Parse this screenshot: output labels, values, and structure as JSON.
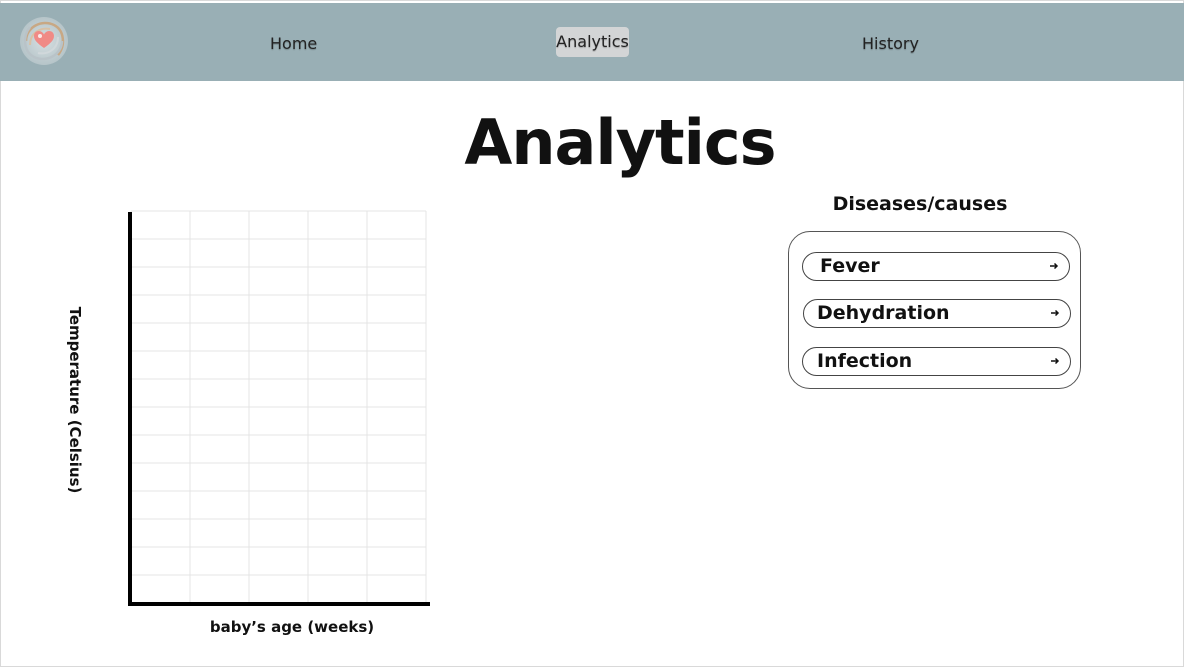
{
  "nav": {
    "logo_name": "heart-swirl-logo",
    "items": [
      {
        "label": "Home",
        "active": false
      },
      {
        "label": "Analytics",
        "active": true
      },
      {
        "label": "History",
        "active": false
      }
    ],
    "background_color": "#99afb5",
    "active_background_color": "#d3d5d6"
  },
  "main": {
    "title": "Analytics"
  },
  "chart_data": {
    "type": "line",
    "title": "",
    "xlabel": "baby’s age (weeks)",
    "ylabel": "Temperature (Celsius)",
    "series": [],
    "grid": true,
    "grid_columns": 5,
    "grid_rows": 14,
    "tick_labels_x": [],
    "tick_labels_y": []
  },
  "diseases": {
    "heading": "Diseases/causes",
    "items": [
      {
        "label": "Fever",
        "icon": "arrow-right-icon"
      },
      {
        "label": "Dehydration",
        "icon": "arrow-right-icon"
      },
      {
        "label": "Infection",
        "icon": "arrow-right-icon"
      }
    ]
  }
}
